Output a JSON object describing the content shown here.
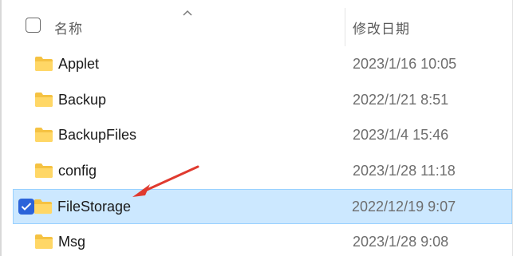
{
  "header": {
    "name_label": "名称",
    "date_label": "修改日期",
    "sort_icon": "chevron-up-icon"
  },
  "rows": [
    {
      "name": "Applet",
      "date": "2023/1/16 10:05",
      "selected": false
    },
    {
      "name": "Backup",
      "date": "2022/1/21 8:51",
      "selected": false
    },
    {
      "name": "BackupFiles",
      "date": "2023/1/4 15:46",
      "selected": false
    },
    {
      "name": "config",
      "date": "2023/1/28 11:18",
      "selected": false
    },
    {
      "name": "FileStorage",
      "date": "2022/12/19 9:07",
      "selected": true
    },
    {
      "name": "Msg",
      "date": "2023/1/28 9:08",
      "selected": false
    }
  ],
  "colors": {
    "folder": "#f5c242",
    "selection_bg": "#cce8ff",
    "checkbox_accent": "#2b63d9",
    "annotation_arrow": "#e03a2f"
  },
  "icons": {
    "folder": "folder-icon",
    "checkbox": "checkbox-icon",
    "annotation": "red-arrow-icon"
  }
}
